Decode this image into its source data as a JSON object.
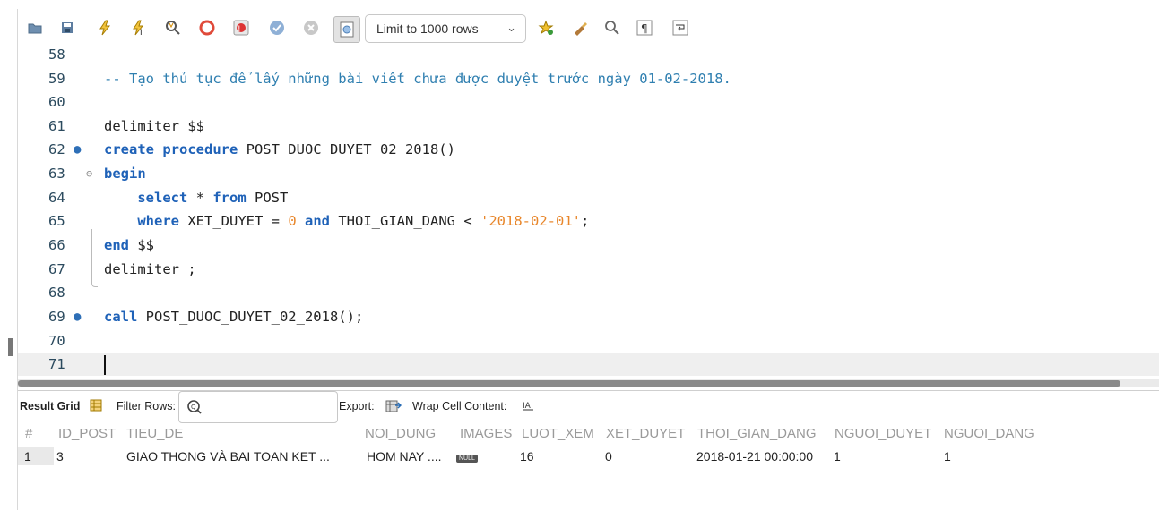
{
  "toolbar": {
    "limit_label": "Limit to 1000 rows"
  },
  "editor": {
    "lines": [
      {
        "num": "58"
      },
      {
        "num": "59",
        "comment": "-- Tạo thủ tục để lấy những bài viết chưa được duyệt trước ngày 01-02-2018."
      },
      {
        "num": "60"
      },
      {
        "num": "61",
        "text": "delimiter $$"
      },
      {
        "num": "62",
        "kw": "create procedure",
        "text": " POST_DUOC_DUYET_02_2018()"
      },
      {
        "num": "63",
        "kw": "begin"
      },
      {
        "num": "64",
        "indent": "    ",
        "kw1": "select",
        "mid": " * ",
        "kw2": "from",
        "text": " POST"
      },
      {
        "num": "65",
        "indent": "    ",
        "kw1": "where",
        "mid": " XET_DUYET = ",
        "num_val": "0",
        "mid2": " ",
        "kw2": "and",
        "mid3": " THOI_GIAN_DANG < ",
        "str_val": "'2018-02-01'",
        "end": ";"
      },
      {
        "num": "66",
        "kw": "end",
        "text": " $$"
      },
      {
        "num": "67",
        "text": "delimiter ;"
      },
      {
        "num": "68"
      },
      {
        "num": "69",
        "kw": "call",
        "text": " POST_DUOC_DUYET_02_2018();"
      },
      {
        "num": "70"
      },
      {
        "num": "71"
      }
    ]
  },
  "results_toolbar": {
    "result_grid": "Result Grid",
    "filter_rows": "Filter Rows:",
    "export": "Export:",
    "wrap": "Wrap Cell Content:"
  },
  "grid": {
    "columns": [
      "#",
      "ID_POST",
      "TIEU_DE",
      "NOI_DUNG",
      "IMAGES",
      "LUOT_XEM",
      "XET_DUYET",
      "THOI_GIAN_DANG",
      "NGUOI_DUYET",
      "NGUOI_DANG"
    ],
    "row": {
      "rownum": "1",
      "id_post": "3",
      "tieu_de": "GIAO THONG VÀ BAI TOAN KET ...",
      "noi_dung": "HOM NAY ....",
      "images": "NULL",
      "luot_xem": "16",
      "xet_duyet": "0",
      "thoi_gian_dang": "2018-01-21 00:00:00",
      "nguoi_duyet": "1",
      "nguoi_dang": "1"
    }
  }
}
